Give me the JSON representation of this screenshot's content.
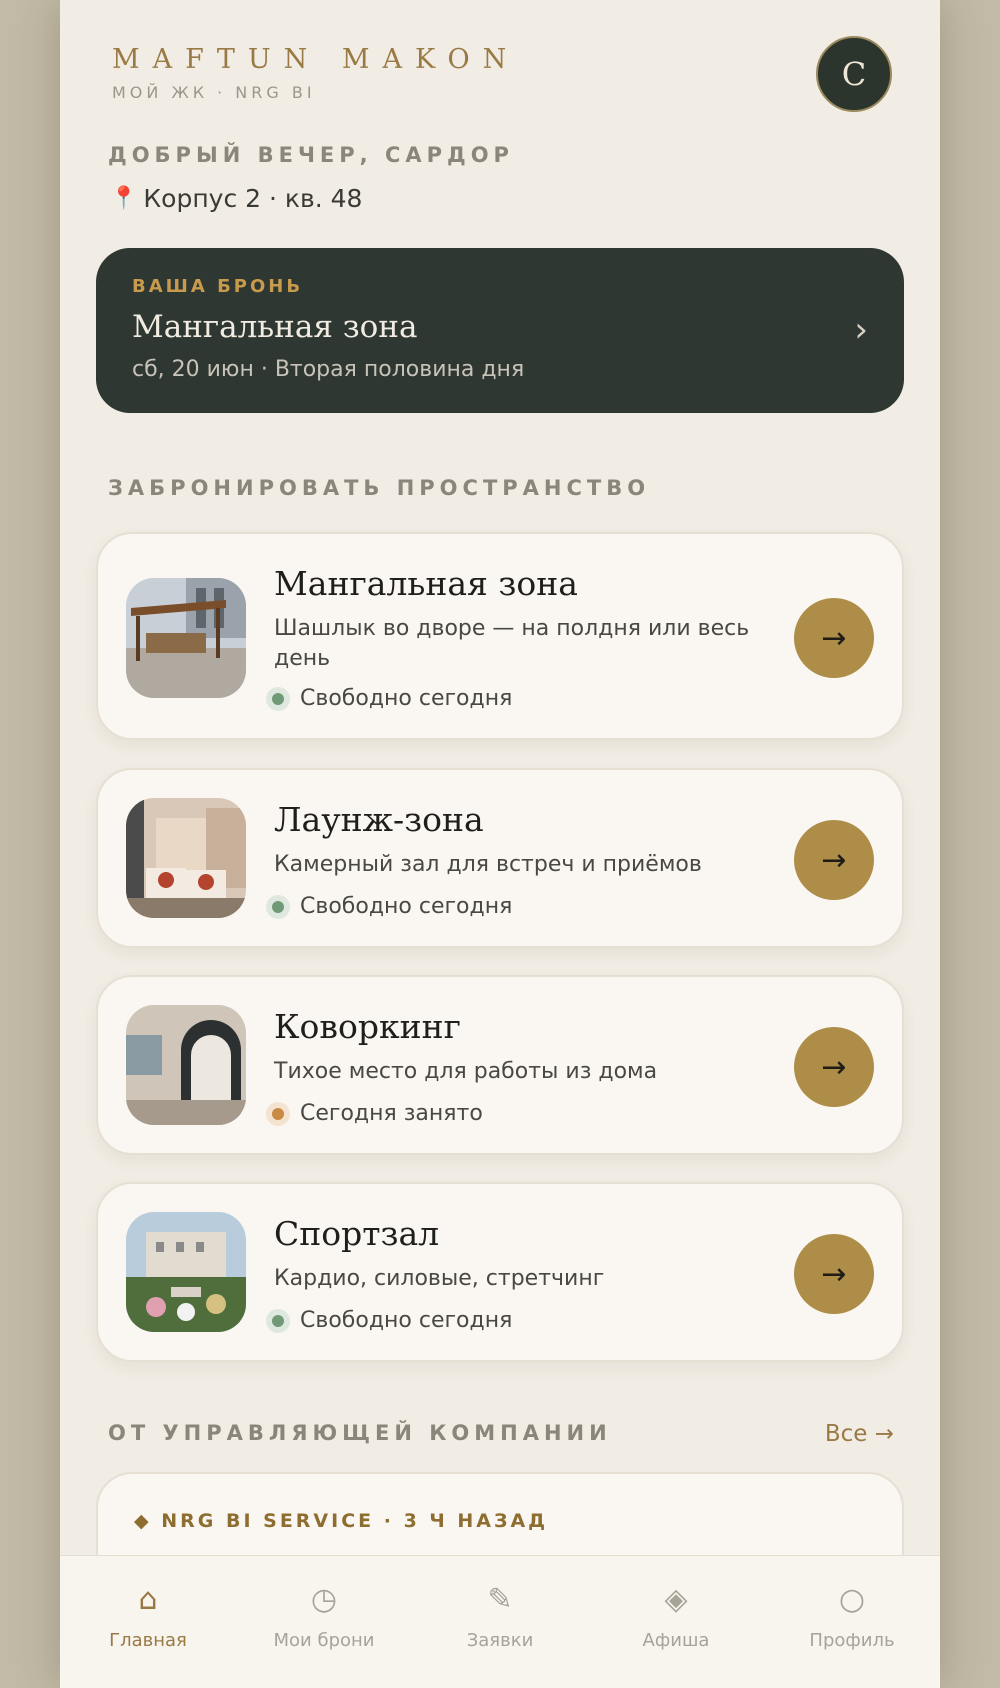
{
  "header": {
    "brand": "MAFTUN MAKON",
    "subtitle": "МОЙ ЖК · NRG BI",
    "avatar_initial": "С"
  },
  "greeting": "ДОБРЫЙ ВЕЧЕР, САРДОР",
  "location": "Корпус 2 · кв. 48",
  "booking": {
    "label": "ВАША БРОНЬ",
    "title": "Мангальная зона",
    "meta": "сб, 20 июн · Вторая половина дня"
  },
  "spaces_section_title": "ЗАБРОНИРОВАТЬ ПРОСТРАНСТВО",
  "spaces": [
    {
      "title": "Мангальная зона",
      "desc": "Шашлык во дворе — на полдня или весь день",
      "status": "Свободно сегодня",
      "status_color": "#6f9a75"
    },
    {
      "title": "Лаунж-зона",
      "desc": "Камерный зал для встреч и приёмов",
      "status": "Свободно сегодня",
      "status_color": "#6f9a75"
    },
    {
      "title": "Коворкинг",
      "desc": "Тихое место для работы из дома",
      "status": "Сегодня занято",
      "status_color": "#c98a43"
    },
    {
      "title": "Спортзал",
      "desc": "Кардио, силовые, стретчинг",
      "status": "Свободно сегодня",
      "status_color": "#6f9a75"
    }
  ],
  "news": {
    "section_title": "ОТ УПРАВЛЯЮЩЕЙ КОМПАНИИ",
    "all_link": "Все →",
    "meta": "◆ NRG BI SERVICE · 3 Ч НАЗАД"
  },
  "tabs": [
    {
      "label": "Главная",
      "icon": "home-icon",
      "active": true
    },
    {
      "label": "Мои брони",
      "icon": "clock-icon",
      "active": false
    },
    {
      "label": "Заявки",
      "icon": "pencil-icon",
      "active": false
    },
    {
      "label": "Афиша",
      "icon": "diamond-icon",
      "active": false
    },
    {
      "label": "Профиль",
      "icon": "circle-icon",
      "active": false
    }
  ],
  "colors": {
    "accent": "#ad8d47",
    "dark": "#2e3731",
    "background": "#f1ece4"
  }
}
